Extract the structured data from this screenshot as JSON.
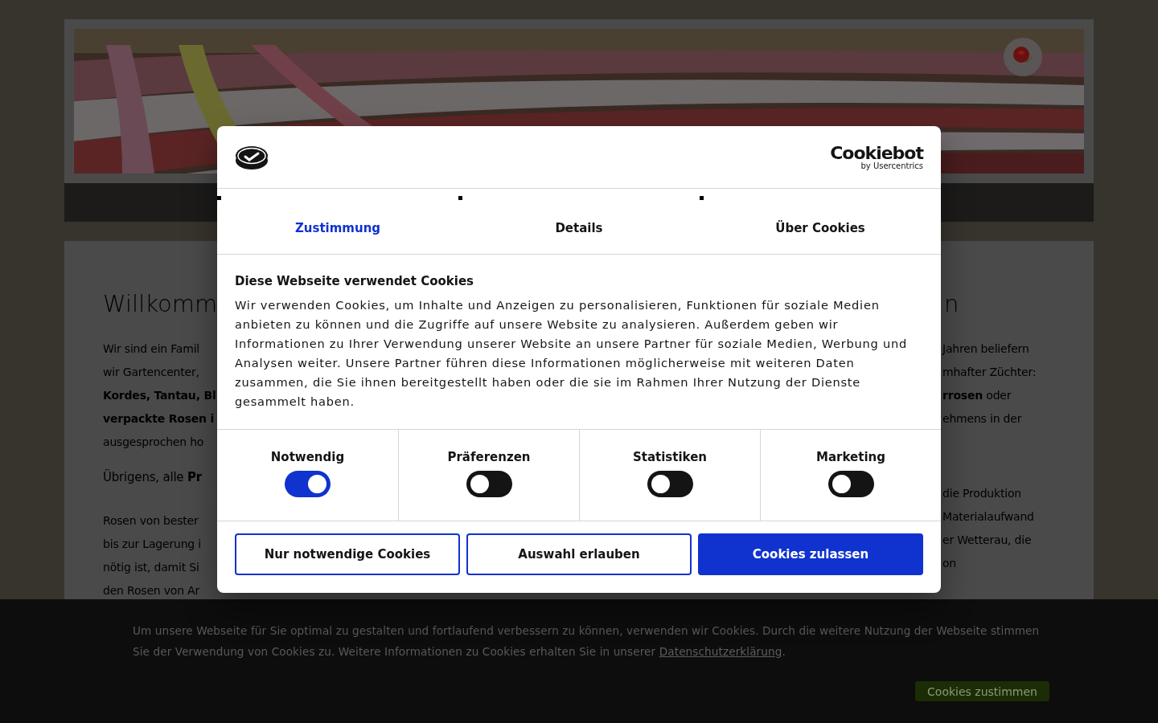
{
  "content": {
    "left": {
      "heading": "Willkomm",
      "lines": [
        "Wir sind ein Famil",
        "wir Gartencenter,",
        "**Kordes, Tantau, Bl**",
        "**verpackte Rosen i**",
        "ausgesprochen ho"
      ],
      "subheading": "Übrigens, alle **Pr**",
      "lines_2": [
        "Rosen von bester",
        "bis zur Lagerung i",
        "nötig ist, damit Si",
        "den Rosen von Ar"
      ]
    },
    "right": {
      "heading": "n",
      "lines": [
        "Jahren beliefern",
        "mhafter Züchter:",
        "**rrosen** oder",
        "ehmens in der"
      ],
      "lines_2": [
        "die Produktion",
        "Materialaufwand",
        "er Wetterau, die",
        "on"
      ]
    }
  },
  "cookie_banner": {
    "text": "Um unsere Webseite für Sie optimal zu gestalten und fortlaufend verbessern zu können, verwenden wir Cookies. Durch die weitere Nutzung der Webseite stimmen Sie der Verwendung von Cookies zu. Weitere Informationen zu Cookies erhalten Sie in unserer ",
    "link": "Datenschutzerklärung",
    "after": ".",
    "button": "Cookies zustimmen"
  },
  "dialog": {
    "brand": "Cookiebot",
    "brand_sub": "by Usercentrics",
    "tabs": [
      {
        "label": "Zustimmung",
        "selected": true
      },
      {
        "label": "Details",
        "selected": false
      },
      {
        "label": "Über Cookies",
        "selected": false
      }
    ],
    "title": "Diese Webseite verwendet Cookies",
    "text": "Wir verwenden Cookies, um Inhalte und Anzeigen zu personalisieren, Funktionen für soziale Medien anbieten zu können und die Zugriffe auf unsere Website zu analysieren. Außerdem geben wir Informationen zu Ihrer Verwendung unserer Website an unsere Partner für soziale Medien, Werbung und Analysen weiter. Unsere Partner führen diese Informationen möglicherweise mit weiteren Daten zusammen, die Sie ihnen bereitgestellt haben oder die sie im Rahmen Ihrer Nutzung der Dienste gesammelt haben.",
    "toggles": [
      {
        "label": "Notwendig",
        "checked": true
      },
      {
        "label": "Präferenzen",
        "checked": false
      },
      {
        "label": "Statistiken",
        "checked": false
      },
      {
        "label": "Marketing",
        "checked": false
      }
    ],
    "buttons": [
      {
        "label": "Nur notwendige Cookies",
        "kind": "outline"
      },
      {
        "label": "Auswahl erlauben",
        "kind": "outline"
      },
      {
        "label": "Cookies zulassen",
        "kind": "primary"
      }
    ]
  }
}
